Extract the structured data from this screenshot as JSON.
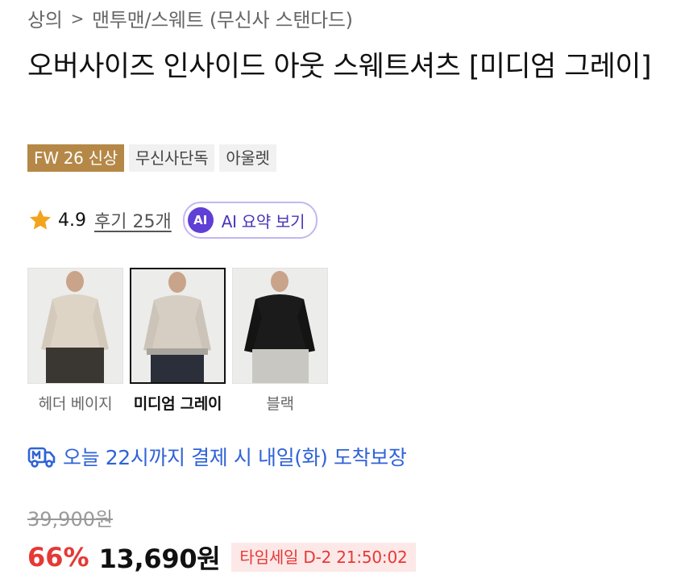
{
  "breadcrumb": {
    "category": "상의",
    "separator": ">",
    "subcategory": "맨투맨/스웨트 (무신사 스탠다드)"
  },
  "product": {
    "title": "오버사이즈 인사이드 아웃 스웨트셔츠 [미디엄 그레이]"
  },
  "tags": [
    "FW 26 신상",
    "무신사단독",
    "아울렛"
  ],
  "rating": {
    "icon": "star-icon",
    "score": "4.9",
    "reviews": "후기 25개",
    "ai_badge": "AI",
    "ai_summary": "AI 요약 보기"
  },
  "colors": [
    {
      "label": "헤더 베이지",
      "selected": false,
      "top": "#ddd4c6",
      "pants": "#3a3632"
    },
    {
      "label": "미디엄 그레이",
      "selected": true,
      "top": "#d6cec2",
      "pants": "#2a2f3a"
    },
    {
      "label": "블랙",
      "selected": false,
      "top": "#1b1b1b",
      "pants": "#c9c7c2"
    }
  ],
  "delivery": {
    "icon": "truck-icon",
    "text": "오늘 22시까지 결제 시 내일(화) 도착보장"
  },
  "price": {
    "original": "39,900원",
    "discount": "66%",
    "sale": "13,690원",
    "timer": "타임세일 D-2 21:50:02"
  },
  "theme": {
    "accent_blue": "#2f63d8",
    "discount_red": "#e53935",
    "new_tag": "#b58847",
    "ai_purple": "#5f3fd6"
  }
}
